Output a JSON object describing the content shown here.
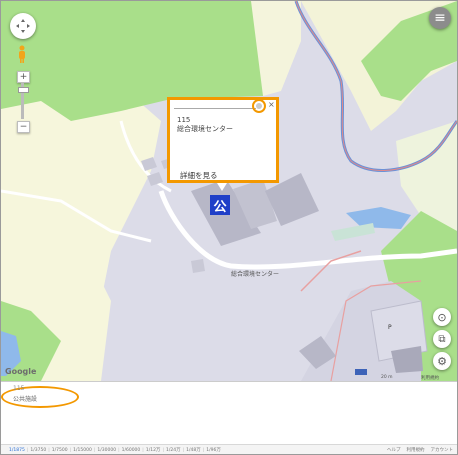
{
  "popup": {
    "code": "115",
    "name": "総合環境センター",
    "detail_link": "詳細を見る",
    "close_glyph": "×"
  },
  "map": {
    "facility_icon_glyph": "公",
    "facility_label": "総合環境センター",
    "google_logo": "Google",
    "scale_label": "20 m",
    "terms_label": "利用規約",
    "parking_glyph": "P",
    "layers_glyph": "⧉",
    "settings_glyph": "⚙",
    "locate_glyph": "⊙",
    "menu_glyph": "≡",
    "zoom_in": "+",
    "zoom_out": "−"
  },
  "info": {
    "code": "115",
    "category": "公共施設"
  },
  "scalebar": {
    "items": [
      "1/1875",
      "1/3750",
      "1/7500",
      "1/15000",
      "1/30000",
      "1/60000",
      "1/12万",
      "1/24万",
      "1/48万",
      "1/96万"
    ],
    "active_index": 0,
    "links": [
      "ヘルプ",
      "利用規約",
      "アカウント"
    ]
  },
  "highlight_color": "#f39800",
  "facility_icon_color": "#1f3fc8"
}
